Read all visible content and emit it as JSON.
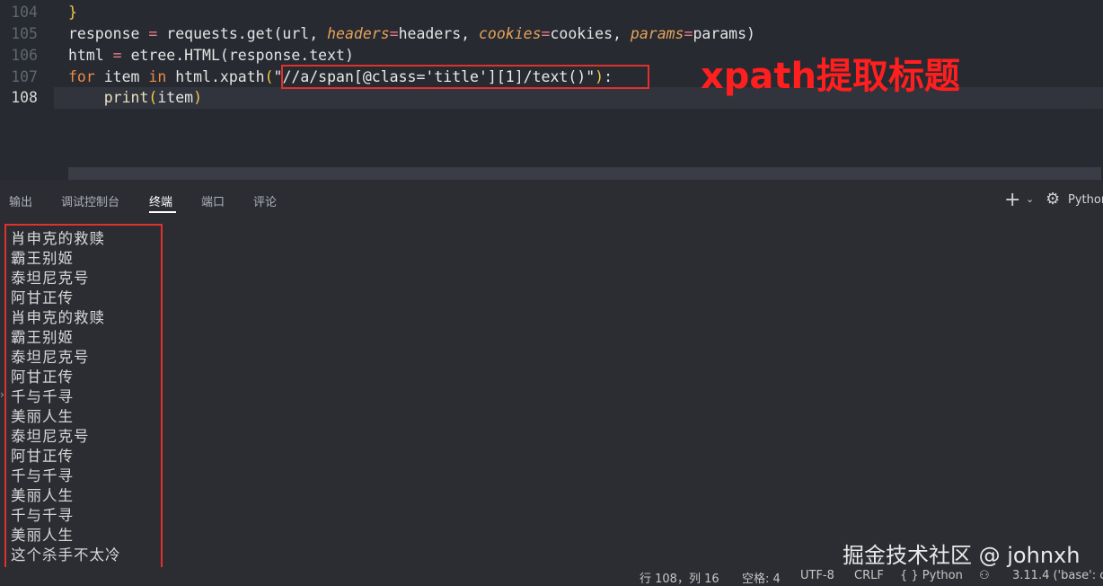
{
  "editor": {
    "gutter": [
      "104",
      "105",
      "106",
      "107",
      "108"
    ],
    "active_line": "108",
    "line104": {
      "brace": "}"
    },
    "line105": {
      "lhs": "response",
      "eq": " = ",
      "call": "requests.get(url, ",
      "p1": "headers",
      "v1": "headers, ",
      "p2": "cookies",
      "v2": "cookies, ",
      "p3": "params",
      "v3": "params)"
    },
    "line106": {
      "lhs": "html",
      "eq": " = ",
      "rest": "etree.HTML(response.text)"
    },
    "line107": {
      "for": "for",
      "item": " item ",
      "in": "in",
      "call": " html.xpath",
      "open": "(",
      "arg": "\"//a/span[@class='title'][1]/text()\"",
      "close": ")",
      "colon": ":"
    },
    "line108": {
      "fn": "print",
      "open": "(",
      "arg": "item",
      "close": ")"
    }
  },
  "annotation": "xpath提取标题",
  "panel": {
    "tabs": [
      "输出",
      "调试控制台",
      "终端",
      "端口",
      "评论"
    ],
    "active_tab": "终端",
    "plus": "+",
    "chevron": "⌄",
    "bug": "⚙",
    "python": "Python"
  },
  "terminal_output": [
    "肖申克的救赎",
    "霸王别姬",
    "泰坦尼克号",
    "阿甘正传",
    "肖申克的救赎",
    "霸王别姬",
    "泰坦尼克号",
    "阿甘正传",
    "千与千寻",
    "美丽人生",
    "泰坦尼克号",
    "阿甘正传",
    "千与千寻",
    "美丽人生",
    "千与千寻",
    "美丽人生",
    "这个杀手不太冷"
  ],
  "watermark": "掘金技术社区 @ johnxh",
  "statusbar": {
    "position": "行 108，列 16",
    "spaces": "空格: 4",
    "encoding": "UTF-8",
    "eol": "CRLF",
    "language": "{ } Python",
    "copilot": "⚇",
    "interpreter": "3.11.4 ('base': c"
  },
  "colors": {
    "highlight_border": "#e0322c",
    "annotation": "#ff1f1f"
  }
}
